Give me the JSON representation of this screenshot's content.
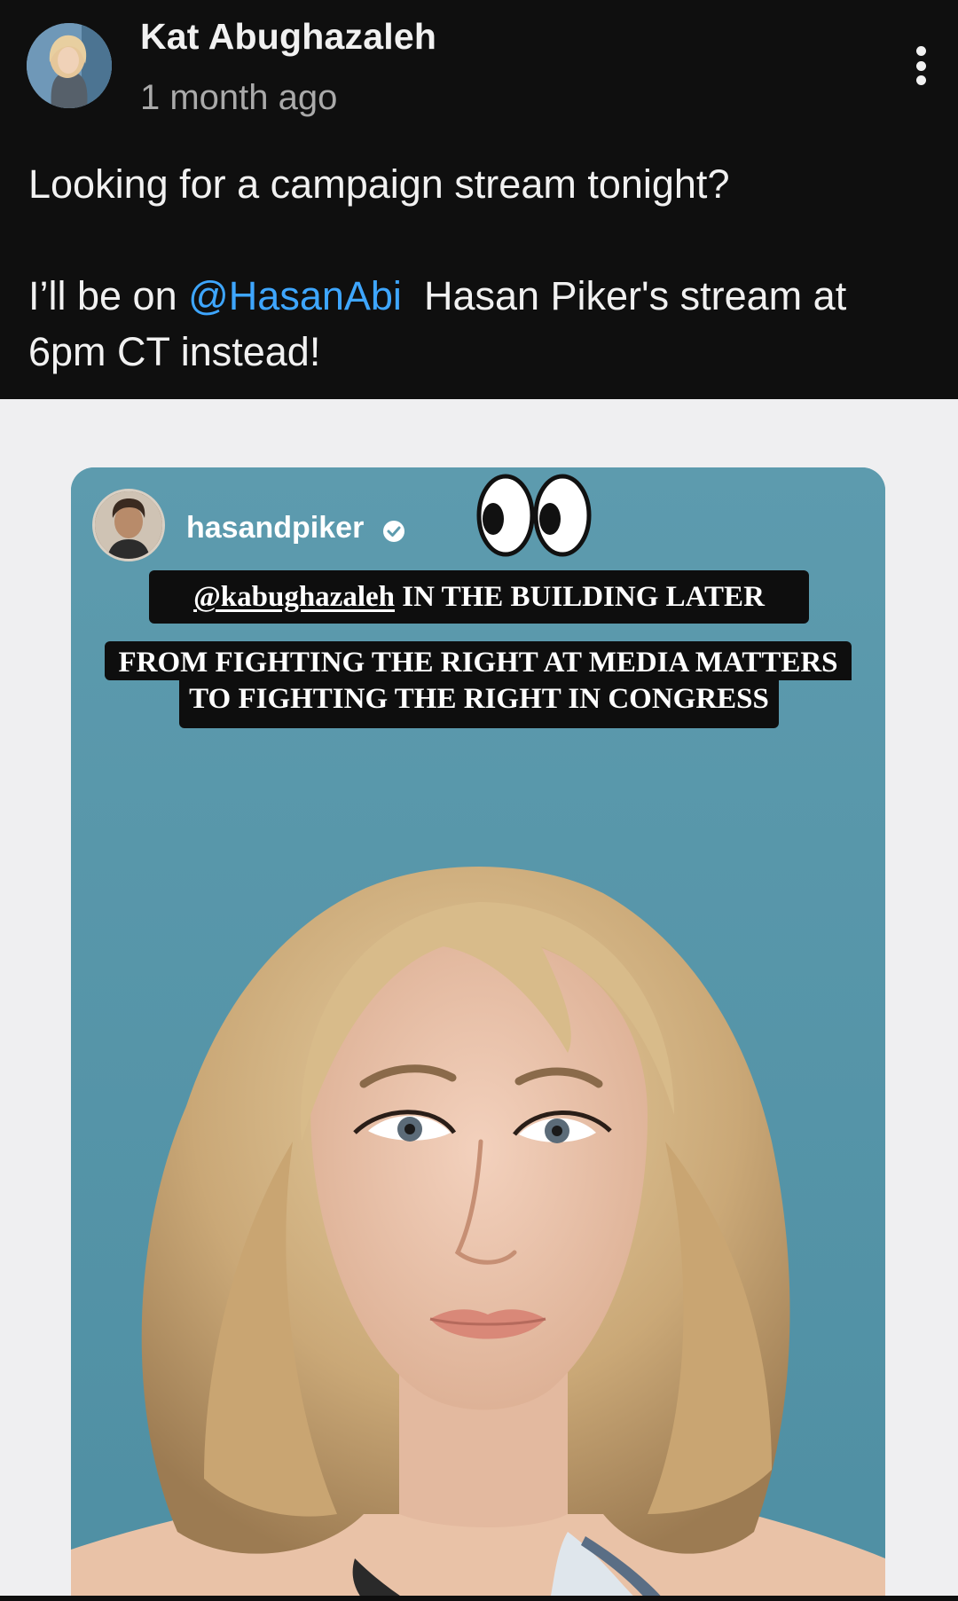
{
  "post": {
    "author": "Kat Abughazaleh",
    "timestamp": "1 month ago",
    "text": {
      "line1": "Looking for a campaign stream tonight?",
      "line2_pre": "I’ll be on ",
      "mention": "@HasanAbi",
      "line2_post": "  Hasan Piker's stream at",
      "line3": "6pm CT instead!"
    }
  },
  "image": {
    "ig_username": "hasandpiker",
    "caption1_handle": "@kabughazaleh",
    "caption1_rest": " IN THE BUILDING LATER",
    "caption2_line1": "FROM FIGHTING THE RIGHT AT MEDIA MATTERS",
    "caption2_line2": "TO FIGHTING THE RIGHT IN CONGRESS"
  },
  "icons": {
    "more": "more-vert-icon",
    "verified": "verified-badge-icon",
    "eyes": "eyes-emoji"
  },
  "colors": {
    "background": "#0f0f0f",
    "text": "#f1f1f1",
    "secondary_text": "#aaaaaa",
    "mention": "#3ea6ff",
    "card_teal": "#5e98aa"
  }
}
